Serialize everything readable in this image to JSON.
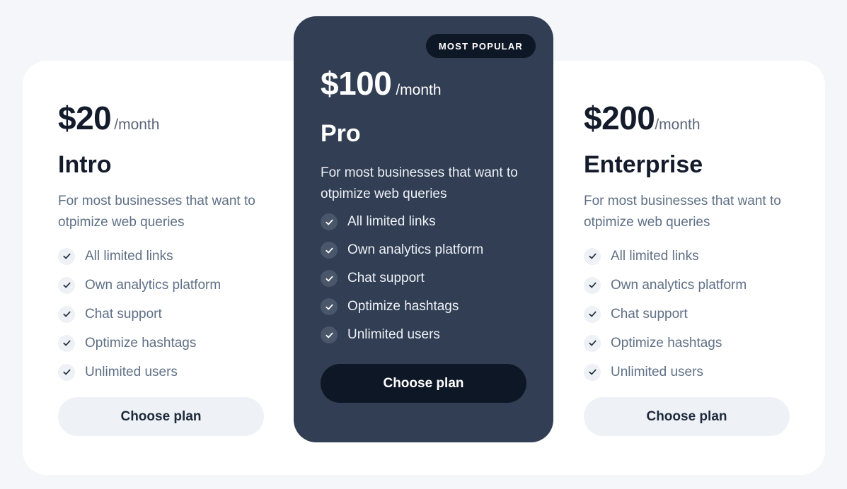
{
  "colors": {
    "page_bg": "#f4f6f9",
    "card_bg": "#ffffff",
    "featured_bg": "#313e53",
    "dark_button": "#0e1726",
    "light_button": "#eef2f6",
    "muted_text": "#5f7086",
    "heading_text": "#141c2c"
  },
  "plans": [
    {
      "price": "$20",
      "period": "/month",
      "name": "Intro",
      "description": "For most businesses that want to otpimize web queries",
      "features": [
        "All limited links",
        "Own analytics platform",
        "Chat support",
        "Optimize hashtags",
        "Unlimited users"
      ],
      "button_label": "Choose plan"
    },
    {
      "badge": "MOST POPULAR",
      "price": "$100",
      "period": "/month",
      "name": "Pro",
      "description": "For most businesses that want to otpimize web queries",
      "features": [
        "All limited links",
        "Own analytics platform",
        "Chat support",
        "Optimize hashtags",
        "Unlimited users"
      ],
      "button_label": "Choose plan"
    },
    {
      "price": "$200",
      "period": "/month",
      "name": "Enterprise",
      "description": "For most businesses that want to otpimize web queries",
      "features": [
        "All limited links",
        "Own analytics platform",
        "Chat support",
        "Optimize hashtags",
        "Unlimited users"
      ],
      "button_label": "Choose plan"
    }
  ],
  "icons": {
    "feature_check": "check-icon"
  }
}
